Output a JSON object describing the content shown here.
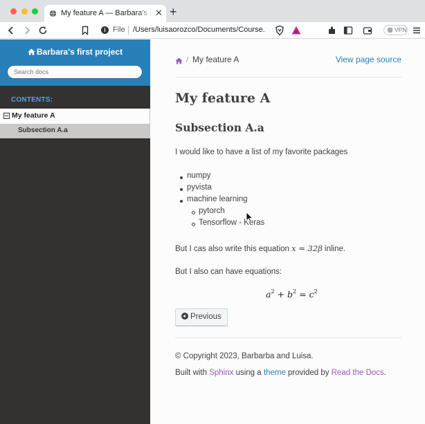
{
  "browser": {
    "tab_title": "My feature A — Barbara's first project documentation",
    "tab_close": "✕",
    "new_tab": "+",
    "url_scheme": "File",
    "url": "/Users/luisaorozco/Documents/Course...",
    "vpn_label": "VPN"
  },
  "sidebar": {
    "project_title": "Barbara's first project",
    "search_placeholder": "Search docs",
    "contents_caption": "CONTENTS:",
    "nav": [
      {
        "label": "My feature A",
        "expanded": true,
        "current": true
      },
      {
        "label": "Subsection A.a",
        "current": true
      }
    ]
  },
  "breadcrumb": {
    "current": "My feature A",
    "separator": "/",
    "view_source": "View page source"
  },
  "content": {
    "title": "My feature A",
    "subtitle": "Subsection A.a",
    "intro": "I would like to have a list of my favorite packages",
    "list": [
      "numpy",
      "pyvista",
      "machine learning"
    ],
    "sublist": [
      "pytorch",
      "Tensorflow - Keras"
    ],
    "inline_sentence_before": "But I cas also write this equation ",
    "inline_math": "x = 32β",
    "inline_sentence_after": " inline.",
    "equations_intro": "But I also can have equations:",
    "display_math": {
      "a": "a",
      "b": "b",
      "c": "c",
      "exp": "2",
      "plus": "+",
      "eq": "="
    },
    "previous_button": "Previous"
  },
  "footer": {
    "copyright": "© Copyright 2023, Barbarba and Luisa.",
    "built_with": "Built with ",
    "sphinx": "Sphinx",
    "using_a": " using a ",
    "theme": "theme",
    "provided_by": " provided by ",
    "rtd": "Read the Docs",
    "period": "."
  },
  "colors": {
    "sidebar_top": "#2980b9",
    "sidebar_bg": "#343131",
    "link": "#2980b9",
    "visited_link": "#9b59b6",
    "caption": "#55a5d9"
  }
}
